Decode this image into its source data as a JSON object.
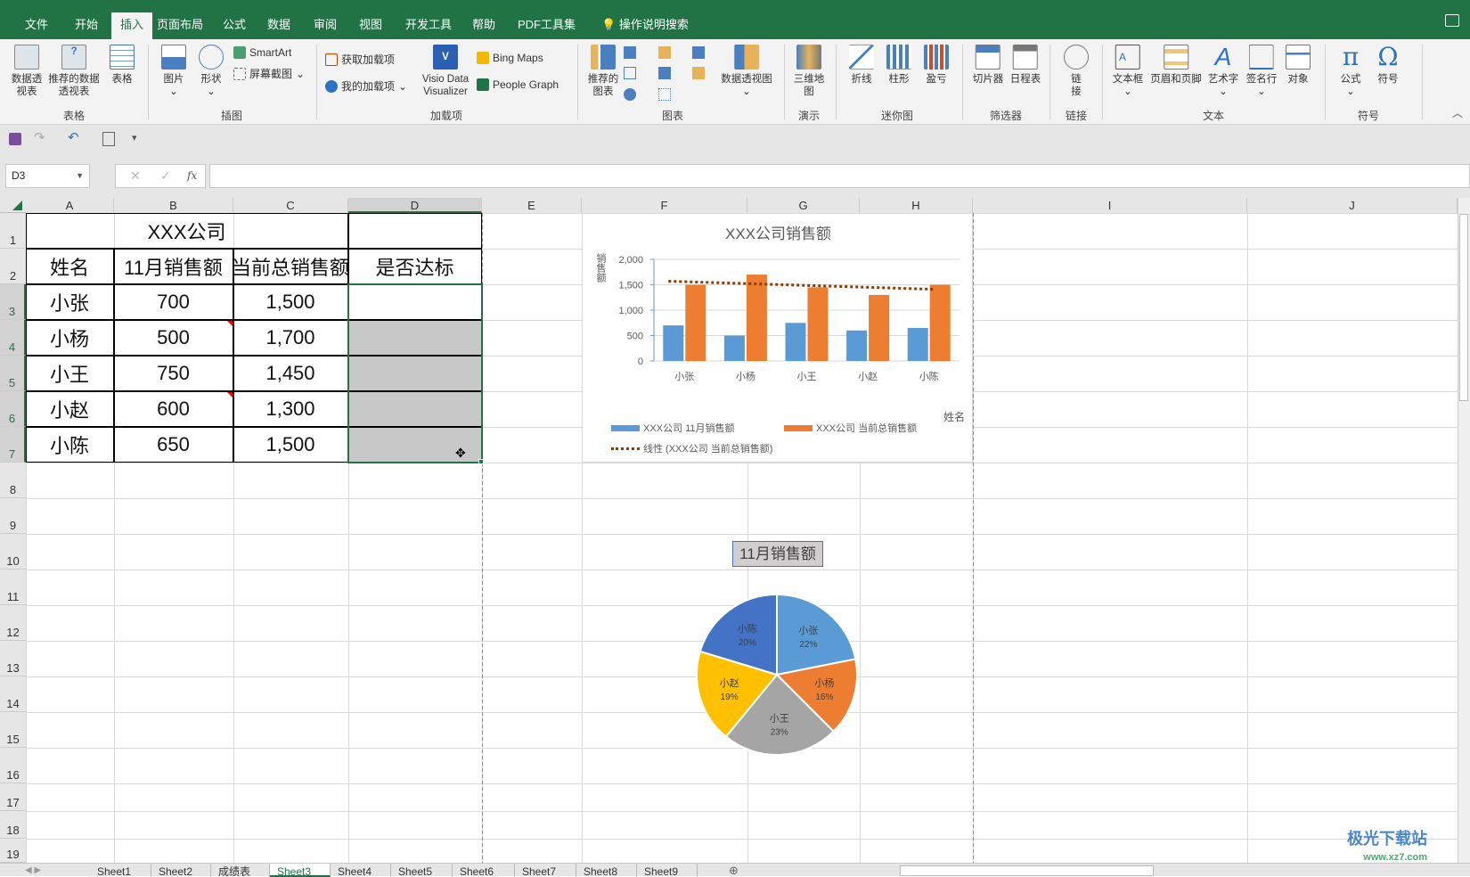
{
  "ribbon_tabs": [
    "文件",
    "开始",
    "插入",
    "页面布局",
    "公式",
    "数据",
    "审阅",
    "视图",
    "开发工具",
    "帮助",
    "PDF工具集",
    "操作说明搜索"
  ],
  "active_tab": "插入",
  "ribbon": {
    "groups": {
      "table": "表格",
      "illustrations": "插图",
      "addins": "加载项",
      "charts": "图表",
      "tours": "演示",
      "sparklines": "迷你图",
      "filters": "筛选器",
      "links": "链接",
      "text": "文本",
      "symbols": "符号"
    },
    "items": {
      "pivot": "数据透视表",
      "rec_pivot": "推荐的数据透视表",
      "table": "表格",
      "pictures": "图片",
      "shapes": "形状",
      "smartart": "SmartArt",
      "screenshot": "屏幕截图",
      "get_addins": "获取加载项",
      "my_addins": "我的加载项",
      "visio": "Visio Data Visualizer",
      "bing": "Bing Maps",
      "people": "People Graph",
      "rec_charts": "推荐的图表",
      "pivot_chart": "数据透视图",
      "map3d": "三维地图",
      "line": "折线",
      "column": "柱形",
      "winloss": "盈亏",
      "slicer": "切片器",
      "timeline": "日程表",
      "link": "链接",
      "textbox": "文本框",
      "header_footer": "页眉和页脚",
      "wordart": "艺术字",
      "signature": "签名行",
      "object": "对象",
      "equation": "公式",
      "symbol": "符号"
    }
  },
  "name_box": "D3",
  "formula": "",
  "columns": [
    "A",
    "B",
    "C",
    "D",
    "E",
    "F",
    "G",
    "H",
    "I",
    "J"
  ],
  "rows": [
    "1",
    "2",
    "3",
    "4",
    "5",
    "6",
    "7",
    "8",
    "9",
    "10",
    "11",
    "12",
    "13",
    "14",
    "15",
    "16",
    "17",
    "18",
    "19"
  ],
  "sheet": {
    "title": "XXX公司",
    "headers": [
      "姓名",
      "11月销售额",
      "当前总销售额",
      "是否达标"
    ],
    "data": [
      [
        "小张",
        "700",
        "1,500",
        ""
      ],
      [
        "小杨",
        "500",
        "1,700",
        ""
      ],
      [
        "小王",
        "750",
        "1,450",
        ""
      ],
      [
        "小赵",
        "600",
        "1,300",
        ""
      ],
      [
        "小陈",
        "650",
        "1,500",
        ""
      ]
    ]
  },
  "sheet_tabs": [
    "Sheet1",
    "Sheet2",
    "成绩表",
    "Sheet3",
    "Sheet4",
    "Sheet5",
    "Sheet6",
    "Sheet7",
    "Sheet8",
    "Sheet9"
  ],
  "active_sheet": "Sheet3",
  "watermark": "极光下载站 www.xz7.com",
  "chart_data": [
    {
      "type": "bar",
      "title": "XXX公司销售额",
      "xlabel": "姓名",
      "ylabel": "销售额",
      "categories": [
        "小张",
        "小杨",
        "小王",
        "小赵",
        "小陈"
      ],
      "series": [
        {
          "name": "XXX公司 11月销售额",
          "values": [
            700,
            500,
            750,
            600,
            650
          ],
          "color": "#5B9BD5"
        },
        {
          "name": "XXX公司 当前总销售额",
          "values": [
            1500,
            1700,
            1450,
            1300,
            1500
          ],
          "color": "#ED7D31"
        }
      ],
      "trendline": {
        "name": "线性 (XXX公司 当前总销售额)",
        "type": "linear",
        "color": "#843C0C"
      },
      "ylim": [
        0,
        2000
      ],
      "yticks": [
        "0",
        "500",
        "1,000",
        "1,500",
        "2,000"
      ],
      "grid": true,
      "legend": "bottom"
    },
    {
      "type": "pie",
      "title": "11月销售额",
      "categories": [
        "小张",
        "小杨",
        "小王",
        "小赵",
        "小陈"
      ],
      "values": [
        700,
        500,
        750,
        600,
        650
      ],
      "labels": [
        "22%",
        "16%",
        "23%",
        "19%",
        "20%"
      ],
      "colors": [
        "#5B9BD5",
        "#ED7D31",
        "#A5A5A5",
        "#FFC000",
        "#4472C4"
      ]
    }
  ]
}
